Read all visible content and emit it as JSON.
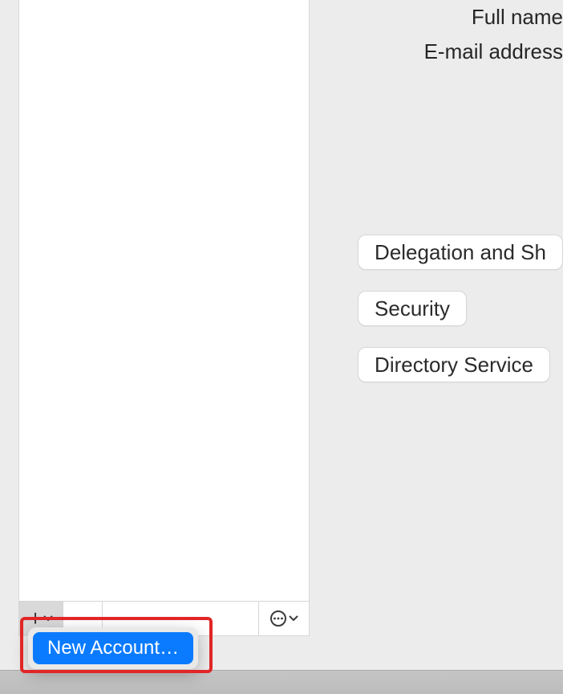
{
  "form": {
    "full_name_label": "Full name",
    "email_label": "E-mail address"
  },
  "buttons": {
    "delegation": "Delegation and Sh",
    "security": "Security",
    "directory": "Directory Service"
  },
  "menu": {
    "new_account": "New Account…"
  }
}
